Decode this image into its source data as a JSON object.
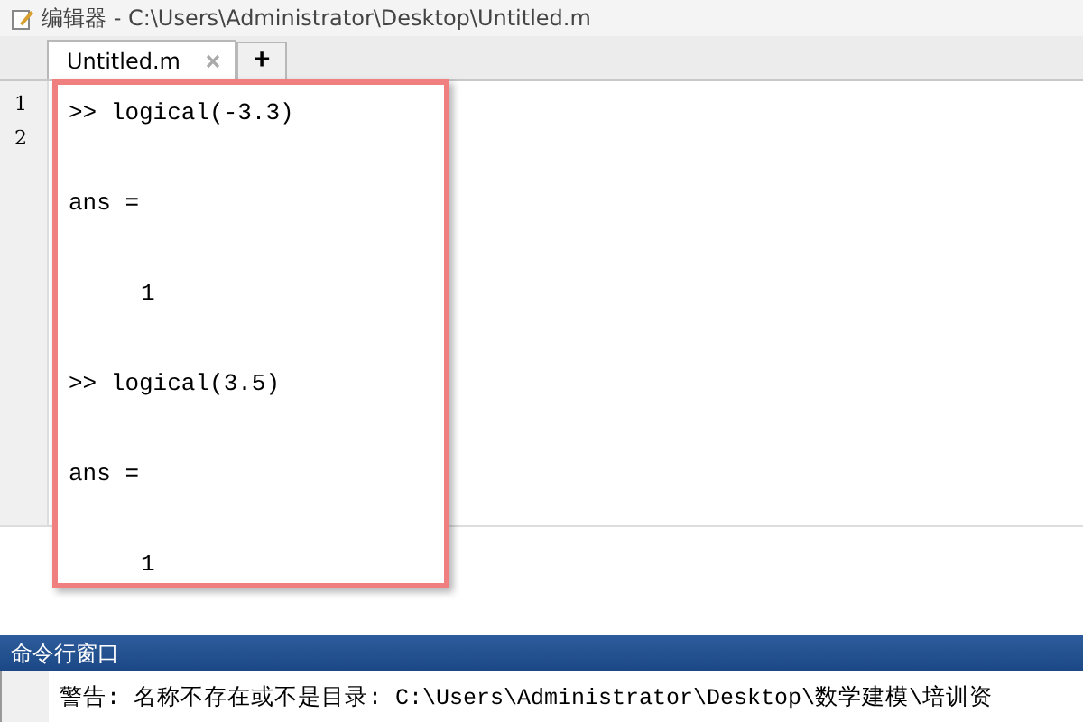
{
  "window": {
    "title": "编辑器 - C:\\Users\\Administrator\\Desktop\\Untitled.m"
  },
  "tabs": [
    {
      "label": "Untitled.m",
      "selected": true
    }
  ],
  "add_tab": "+",
  "editor": {
    "line_numbers": [
      "1",
      "2"
    ]
  },
  "screenshot": {
    "lines": [
      {
        "kind": "prompt",
        "text": ">> logical(-3.3)"
      },
      {
        "kind": "output",
        "text": "ans ="
      },
      {
        "kind": "value",
        "text": "1"
      },
      {
        "kind": "prompt",
        "text": ">> logical(3.5)"
      },
      {
        "kind": "output",
        "text": "ans ="
      },
      {
        "kind": "value",
        "text": "1"
      }
    ]
  },
  "command_window": {
    "title": "命令行窗口",
    "message": "警告: 名称不存在或不是目录: C:\\Users\\Administrator\\Desktop\\数学建模\\培训资"
  }
}
